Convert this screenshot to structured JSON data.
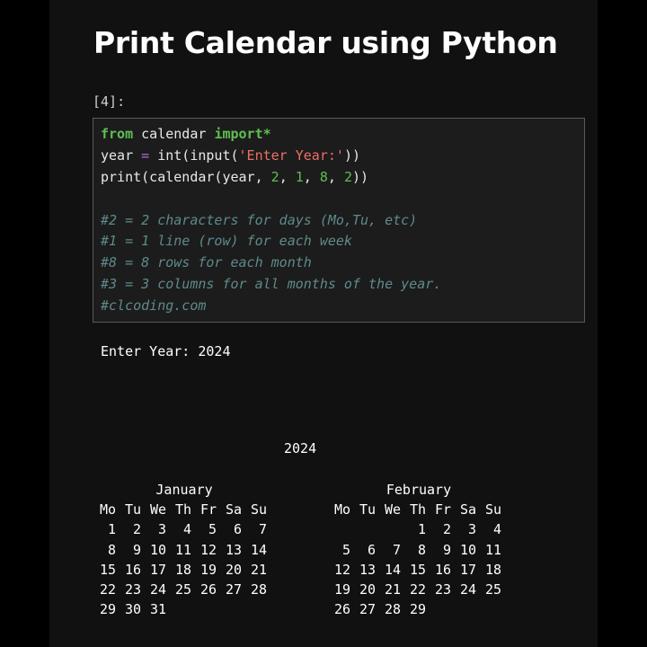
{
  "title": "Print Calendar using Python",
  "cell": {
    "prompt": "[4]:",
    "code": {
      "line1_kw1": "from",
      "line1_mid": " calendar ",
      "line1_kw2": "import*",
      "line2_a": "year ",
      "line2_op": "=",
      "line2_b": " int(input(",
      "line2_str": "'Enter Year:'",
      "line2_c": "))",
      "line3_a": "print(calendar(year, ",
      "line3_n1": "2",
      "line3_s1": ", ",
      "line3_n2": "1",
      "line3_s2": ", ",
      "line3_n3": "8",
      "line3_s3": ", ",
      "line3_n4": "2",
      "line3_end": "))",
      "comments": [
        "#2 = 2 characters for days (Mo,Tu, etc)",
        "#1 = 1 line (row) for each week",
        "#8 = 8 rows for each month",
        "#3 = 3 columns for all months of the year.",
        "#clcoding.com"
      ]
    }
  },
  "output": {
    "input_line": "Enter Year: 2024",
    "year": "2024",
    "weekday_headers": [
      "Mo",
      "Tu",
      "We",
      "Th",
      "Fr",
      "Sa",
      "Su"
    ],
    "months": [
      {
        "name": "January",
        "weeks": [
          [
            "1",
            "2",
            "3",
            "4",
            "5",
            "6",
            "7"
          ],
          [
            "8",
            "9",
            "10",
            "11",
            "12",
            "13",
            "14"
          ],
          [
            "15",
            "16",
            "17",
            "18",
            "19",
            "20",
            "21"
          ],
          [
            "22",
            "23",
            "24",
            "25",
            "26",
            "27",
            "28"
          ],
          [
            "29",
            "30",
            "31",
            "",
            "",
            "",
            ""
          ]
        ]
      },
      {
        "name": "February",
        "weeks": [
          [
            "",
            "",
            "",
            "1",
            "2",
            "3",
            "4"
          ],
          [
            "5",
            "6",
            "7",
            "8",
            "9",
            "10",
            "11"
          ],
          [
            "12",
            "13",
            "14",
            "15",
            "16",
            "17",
            "18"
          ],
          [
            "19",
            "20",
            "21",
            "22",
            "23",
            "24",
            "25"
          ],
          [
            "26",
            "27",
            "28",
            "29",
            "",
            "",
            ""
          ]
        ]
      }
    ]
  }
}
